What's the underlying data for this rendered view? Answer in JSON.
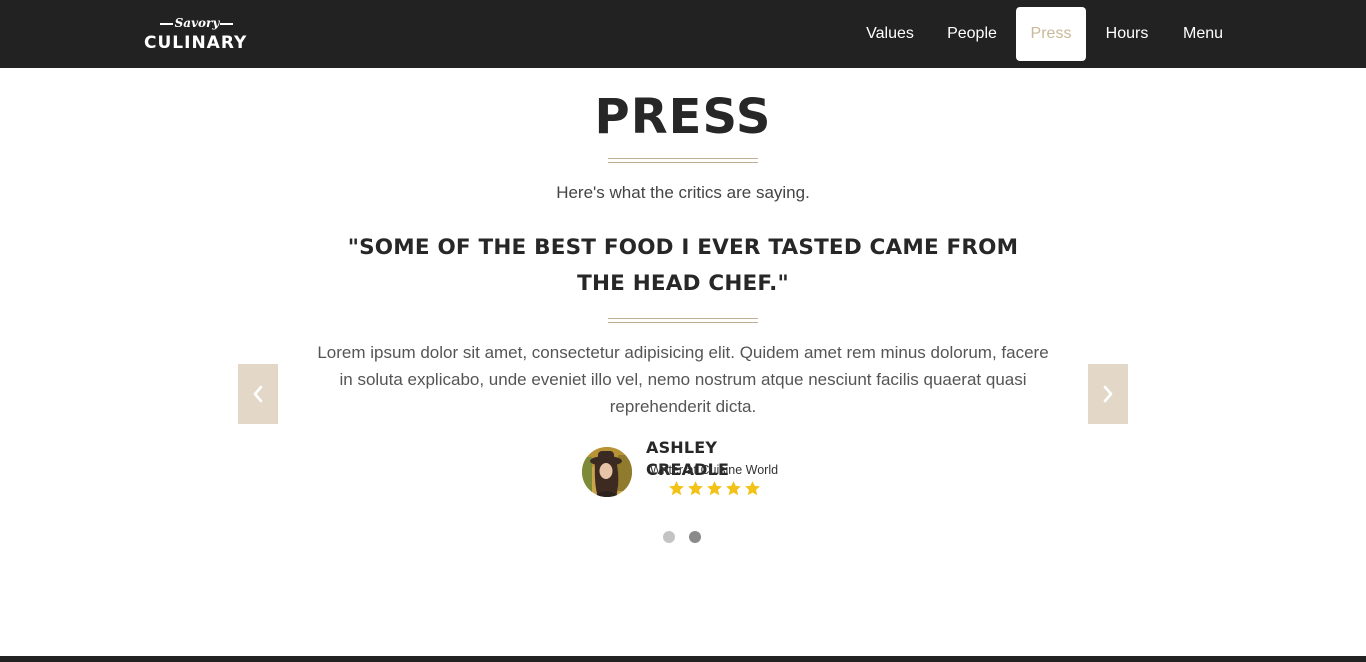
{
  "brand": {
    "script_word": "Savory",
    "name": "CULINARY"
  },
  "nav": {
    "items": [
      {
        "label": "Values",
        "active": false
      },
      {
        "label": "People",
        "active": false
      },
      {
        "label": "Press",
        "active": true
      },
      {
        "label": "Hours",
        "active": false
      },
      {
        "label": "Menu",
        "active": false
      }
    ]
  },
  "section": {
    "title": "PRESS",
    "subtitle": "Here's what the critics are saying."
  },
  "testimonial": {
    "quote": "\"SOME OF THE BEST FOOD I EVER TASTED CAME FROM THE HEAD CHEF.\"",
    "body": "Lorem ipsum dolor sit amet, consectetur adipisicing elit. Quidem amet rem minus dolorum, facere in soluta explicabo, unde eveniet illo vel, nemo nostrum atque nesciunt facilis quaerat quasi reprehenderit dicta.",
    "author_name": "ASHLEY CREADLE",
    "author_role": "Writer at Cuisine World",
    "rating": 5,
    "rating_max": 5
  },
  "carousel": {
    "slide_count": 2,
    "active_slide": 2
  },
  "colors": {
    "nav_bg": "#222222",
    "accent_tan": "#c9b89a",
    "arrow_bg": "#e3d8c7",
    "star": "#f2c218",
    "dot_inactive": "#c4c4c4",
    "dot_active": "#8a8a8a"
  },
  "icons": {
    "prev": "chevron-left-icon",
    "next": "chevron-right-icon",
    "rating": "star-icon"
  }
}
